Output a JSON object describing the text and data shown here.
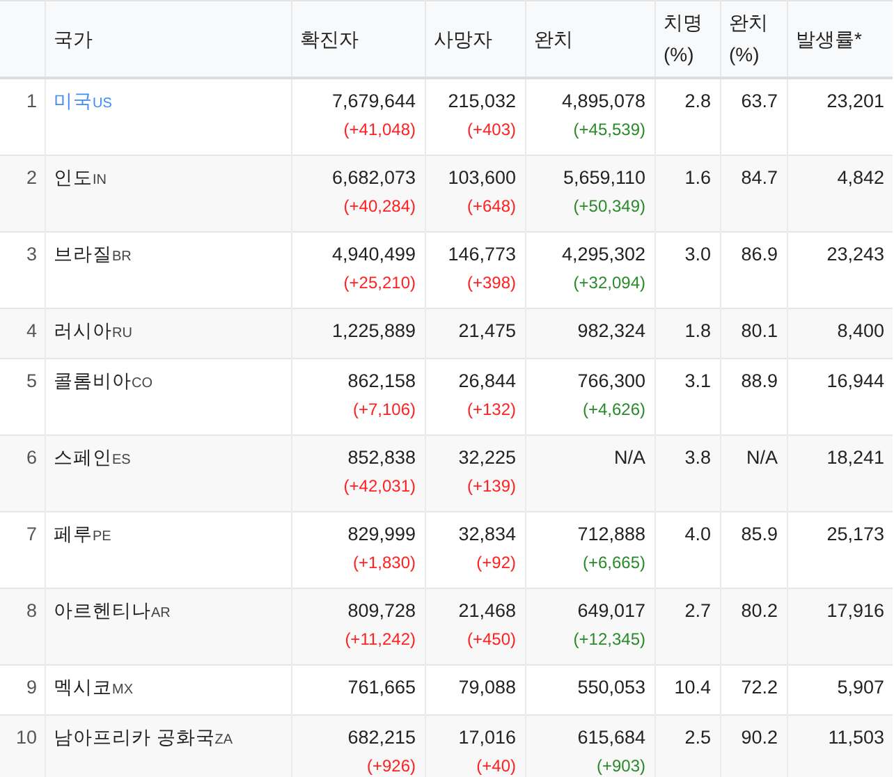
{
  "table": {
    "columns": [
      "국가",
      "확진자",
      "사망자",
      "완치",
      "치명 (%)",
      "완치 (%)",
      "발생률*"
    ],
    "rows": [
      {
        "rank": "1",
        "country": "미국",
        "code": "US",
        "link": true,
        "cases": "7,679,644",
        "cases_change": "(+41,048)",
        "deaths": "215,032",
        "deaths_change": "(+403)",
        "recovered": "4,895,078",
        "recovered_change": "(+45,539)",
        "fatality": "2.8",
        "recovery_rate": "63.7",
        "incidence": "23,201"
      },
      {
        "rank": "2",
        "country": "인도",
        "code": "IN",
        "link": false,
        "cases": "6,682,073",
        "cases_change": "(+40,284)",
        "deaths": "103,600",
        "deaths_change": "(+648)",
        "recovered": "5,659,110",
        "recovered_change": "(+50,349)",
        "fatality": "1.6",
        "recovery_rate": "84.7",
        "incidence": "4,842"
      },
      {
        "rank": "3",
        "country": "브라질",
        "code": "BR",
        "link": false,
        "cases": "4,940,499",
        "cases_change": "(+25,210)",
        "deaths": "146,773",
        "deaths_change": "(+398)",
        "recovered": "4,295,302",
        "recovered_change": "(+32,094)",
        "fatality": "3.0",
        "recovery_rate": "86.9",
        "incidence": "23,243"
      },
      {
        "rank": "4",
        "country": "러시아",
        "code": "RU",
        "link": false,
        "cases": "1,225,889",
        "deaths": "21,475",
        "recovered": "982,324",
        "fatality": "1.8",
        "recovery_rate": "80.1",
        "incidence": "8,400"
      },
      {
        "rank": "5",
        "country": "콜롬비아",
        "code": "CO",
        "link": false,
        "cases": "862,158",
        "cases_change": "(+7,106)",
        "deaths": "26,844",
        "deaths_change": "(+132)",
        "recovered": "766,300",
        "recovered_change": "(+4,626)",
        "fatality": "3.1",
        "recovery_rate": "88.9",
        "incidence": "16,944"
      },
      {
        "rank": "6",
        "country": "스페인",
        "code": "ES",
        "link": false,
        "cases": "852,838",
        "cases_change": "(+42,031)",
        "deaths": "32,225",
        "deaths_change": "(+139)",
        "recovered": "N/A",
        "fatality": "3.8",
        "recovery_rate": "N/A",
        "incidence": "18,241"
      },
      {
        "rank": "7",
        "country": "페루",
        "code": "PE",
        "link": false,
        "cases": "829,999",
        "cases_change": "(+1,830)",
        "deaths": "32,834",
        "deaths_change": "(+92)",
        "recovered": "712,888",
        "recovered_change": "(+6,665)",
        "fatality": "4.0",
        "recovery_rate": "85.9",
        "incidence": "25,173"
      },
      {
        "rank": "8",
        "country": "아르헨티나",
        "code": "AR",
        "link": false,
        "cases": "809,728",
        "cases_change": "(+11,242)",
        "deaths": "21,468",
        "deaths_change": "(+450)",
        "recovered": "649,017",
        "recovered_change": "(+12,345)",
        "fatality": "2.7",
        "recovery_rate": "80.2",
        "incidence": "17,916"
      },
      {
        "rank": "9",
        "country": "멕시코",
        "code": "MX",
        "link": false,
        "cases": "761,665",
        "deaths": "79,088",
        "recovered": "550,053",
        "fatality": "10.4",
        "recovery_rate": "72.2",
        "incidence": "5,907"
      },
      {
        "rank": "10",
        "country": "남아프리카 공화국",
        "code": "ZA",
        "link": false,
        "cases": "682,215",
        "cases_change": "(+926)",
        "deaths": "17,016",
        "deaths_change": "(+40)",
        "recovered": "615,684",
        "recovered_change": "(+903)",
        "fatality": "2.5",
        "recovery_rate": "90.2",
        "incidence": "11,503"
      }
    ]
  }
}
